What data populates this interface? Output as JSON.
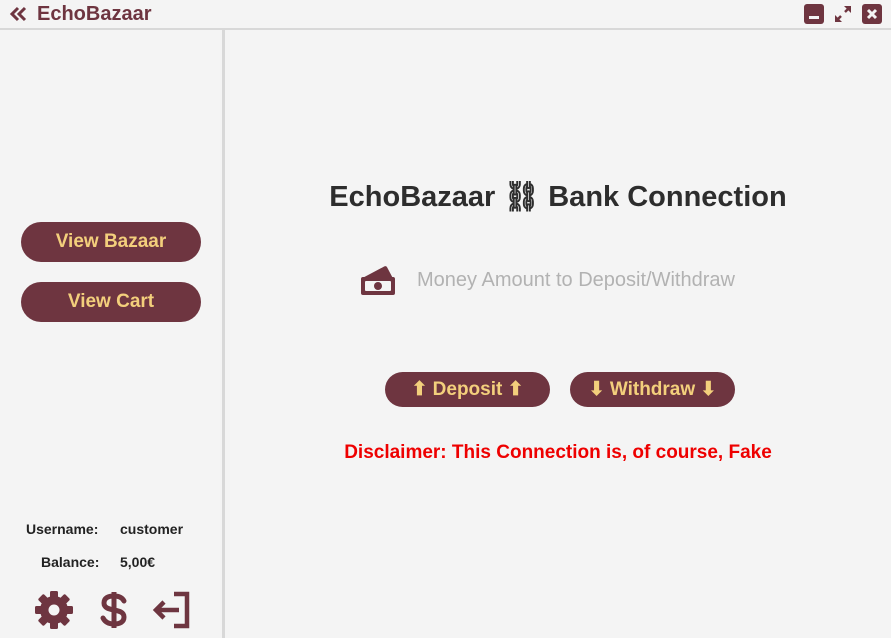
{
  "window": {
    "title": "EchoBazaar",
    "icons": [
      "chevron-double-left-icon",
      "minimize-icon",
      "maximize-icon",
      "close-icon"
    ]
  },
  "sidebar": {
    "view_bazaar_label": "View Bazaar",
    "view_cart_label": "View Cart",
    "username_label": "Username:",
    "username_value": "customer",
    "balance_label": "Balance:",
    "balance_value": "5,00€",
    "bottom_icons": [
      "gear-icon",
      "dollar-icon",
      "logout-icon"
    ]
  },
  "main": {
    "title": "EchoBazaar ⛓ Bank Connection",
    "amount_placeholder": "Money Amount to Deposit/Withdraw",
    "amount_value": "",
    "deposit_label": "⬆ Deposit ⬆",
    "withdraw_label": "⬇ Withdraw ⬇",
    "disclaimer": "Disclaimer: This Connection is, of course, Fake"
  },
  "colors": {
    "accent": "#6e3540",
    "button_text": "#f3cf7c",
    "disclaimer": "#ee0000",
    "background": "#f4f4f4"
  }
}
